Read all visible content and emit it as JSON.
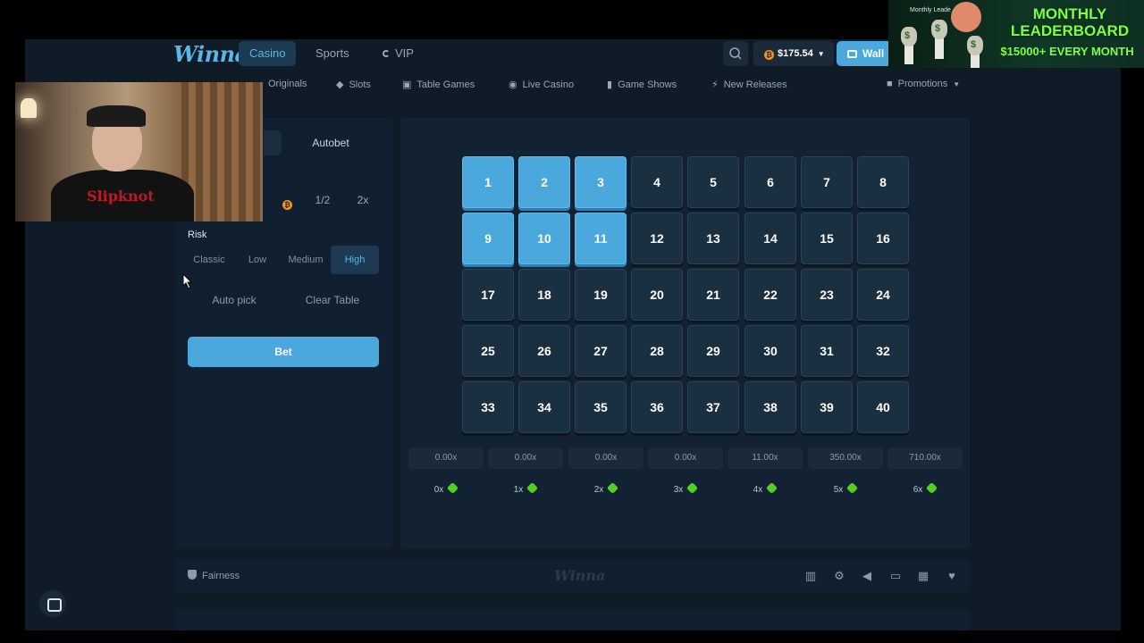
{
  "nav": {
    "logo": "Winna",
    "casino": "Casino",
    "sports": "Sports",
    "vip": "VIP",
    "balance": "$175.54",
    "wallet": "Wall"
  },
  "subnav": {
    "originals": "Originals",
    "slots": "Slots",
    "table_games": "Table Games",
    "live_casino": "Live Casino",
    "game_shows": "Game Shows",
    "new_releases": "New Releases",
    "promotions": "Promotions"
  },
  "controls": {
    "autobet_tab": "Autobet",
    "half": "1/2",
    "double": "2x",
    "risk_label": "Risk",
    "risk_options": [
      "Classic",
      "Low",
      "Medium",
      "High"
    ],
    "risk_selected": "High",
    "auto_pick": "Auto pick",
    "clear_table": "Clear Table",
    "bet": "Bet"
  },
  "board": {
    "tiles": [
      "1",
      "2",
      "3",
      "4",
      "5",
      "6",
      "7",
      "8",
      "9",
      "10",
      "11",
      "12",
      "13",
      "14",
      "15",
      "16",
      "17",
      "18",
      "19",
      "20",
      "21",
      "22",
      "23",
      "24",
      "25",
      "26",
      "27",
      "28",
      "29",
      "30",
      "31",
      "32",
      "33",
      "34",
      "35",
      "36",
      "37",
      "38",
      "39",
      "40"
    ],
    "selected": [
      1,
      2,
      3,
      9,
      10,
      11
    ],
    "payouts": [
      "0.00x",
      "0.00x",
      "0.00x",
      "0.00x",
      "11.00x",
      "350.00x",
      "710.00x"
    ],
    "hits": [
      "0x",
      "1x",
      "2x",
      "3x",
      "4x",
      "5x",
      "6x"
    ]
  },
  "footer": {
    "fairness": "Fairness",
    "logo": "Winna"
  },
  "overlay": {
    "banner_small": "Monthly Leade",
    "banner_title": "MONTHLY LEADERBOARD",
    "banner_sub": "$15000+ EVERY MONTH",
    "shirt_text": "Slipknot"
  },
  "colors": {
    "accent": "#4aa8dc",
    "background": "#0f1b27",
    "panel": "#112030",
    "gem": "#4fd11d"
  },
  "icons": {
    "search": "search-icon",
    "btc": "bitcoin-icon",
    "wallet": "wallet-icon",
    "chat": "chat-icon"
  }
}
